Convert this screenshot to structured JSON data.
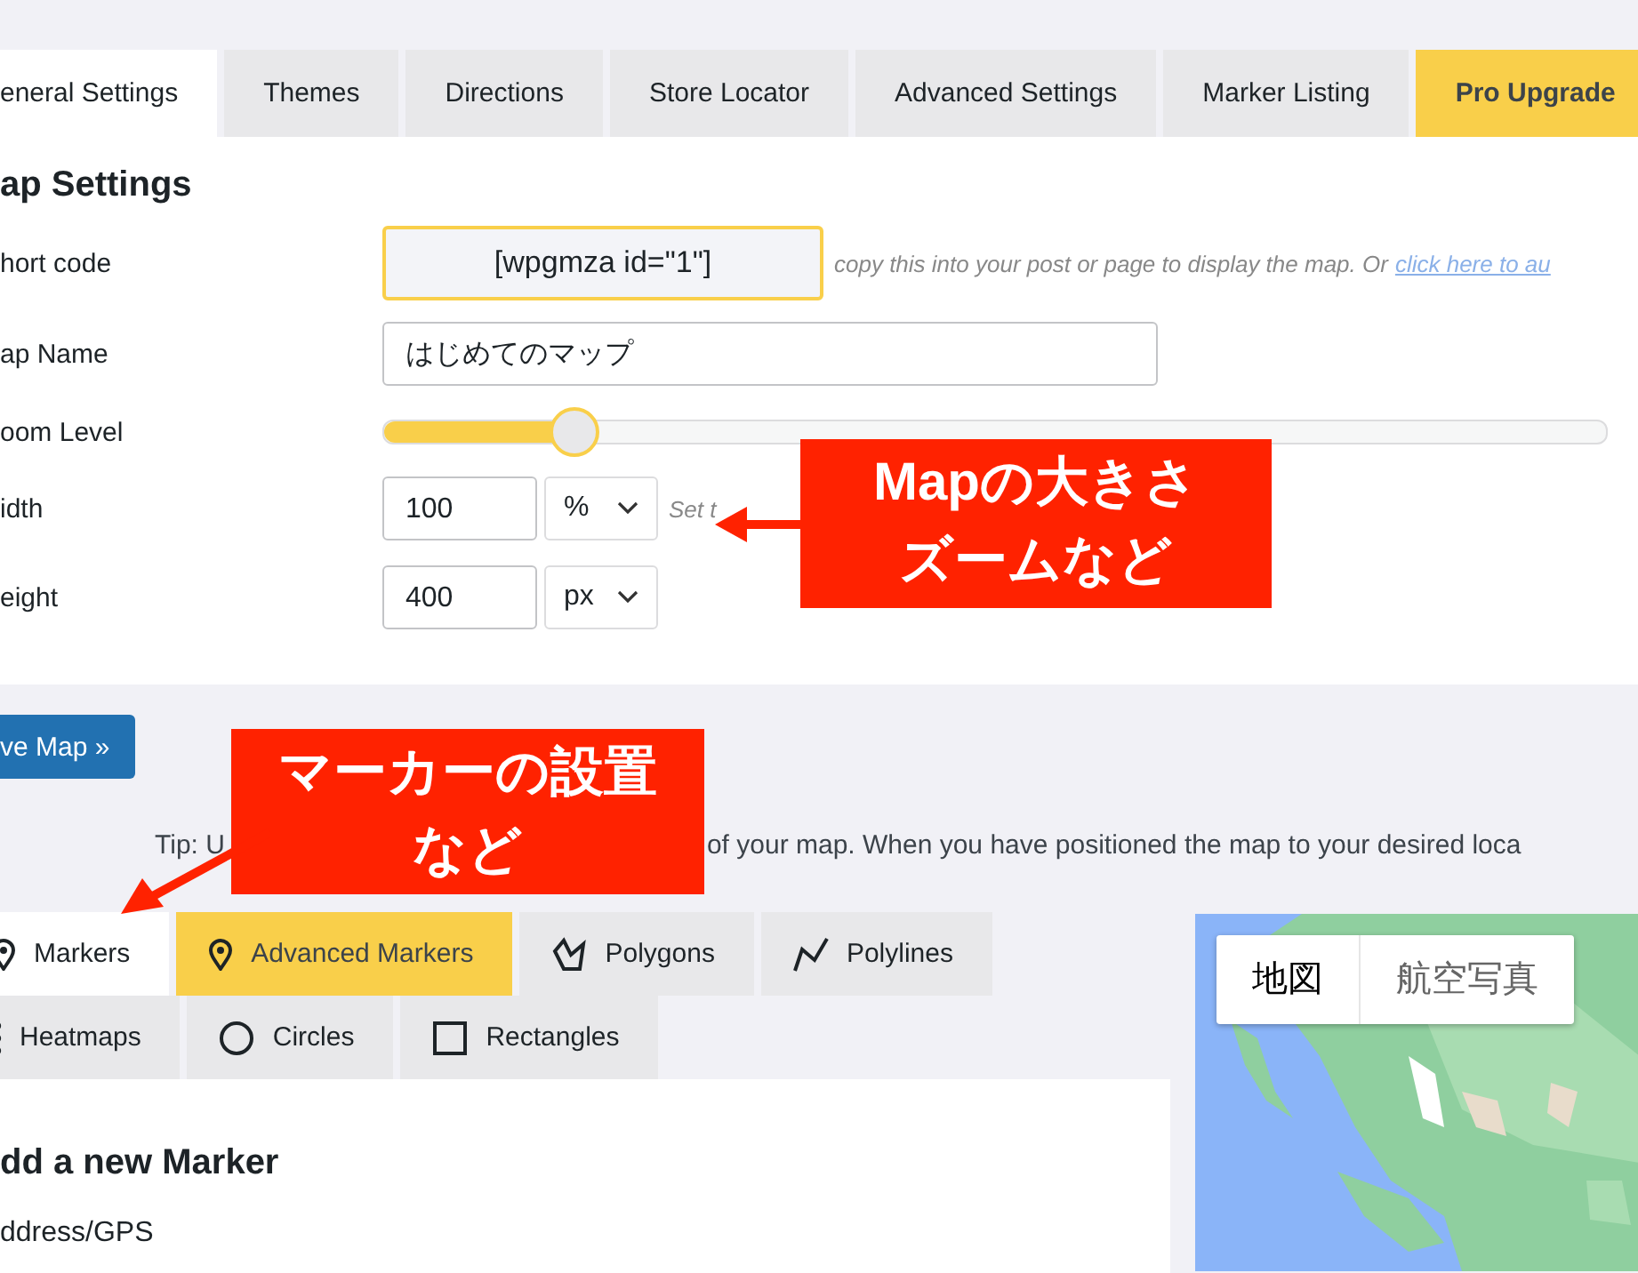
{
  "top_tabs": [
    {
      "label": "eneral Settings",
      "selected": true,
      "kind": "tab"
    },
    {
      "label": "Themes",
      "selected": false,
      "kind": "tab"
    },
    {
      "label": "Directions",
      "selected": false,
      "kind": "tab"
    },
    {
      "label": "Store Locator",
      "selected": false,
      "kind": "tab"
    },
    {
      "label": "Advanced Settings",
      "selected": false,
      "kind": "tab"
    },
    {
      "label": "Marker Listing",
      "selected": false,
      "kind": "tab"
    },
    {
      "label": "Pro Upgrade",
      "selected": false,
      "kind": "upgrade"
    }
  ],
  "map_settings": {
    "heading": "ap Settings",
    "rows": [
      {
        "kind": "shortcode",
        "label": "hort code",
        "value": "[wpgmza id=\"1\"]",
        "hint": "copy this into your post or page to display the map. Or",
        "link": "click here to au"
      },
      {
        "kind": "text",
        "label": "ap Name",
        "value": "はじめてのマップ"
      },
      {
        "kind": "slider",
        "label": "oom Level",
        "level": 0.155
      },
      {
        "kind": "size",
        "label": "idth",
        "value": "100",
        "unit": "%",
        "hint": "Set t"
      },
      {
        "kind": "size",
        "label": "eight",
        "value": "400",
        "unit": "px"
      }
    ]
  },
  "save_button": "ve Map »",
  "tip": {
    "before": "Tip: U",
    "after": "of your map. When you have positioned the map to your desired loca"
  },
  "feature_tabs": [
    [
      {
        "label": "Markers",
        "kind": "pin",
        "selected": true,
        "pro": false
      },
      {
        "label": "Advanced Markers",
        "kind": "pin",
        "selected": false,
        "pro": true
      },
      {
        "label": "Polygons",
        "kind": "polygon",
        "selected": false,
        "pro": false
      },
      {
        "label": "Polylines",
        "kind": "polyline",
        "selected": false,
        "pro": false
      }
    ],
    [
      {
        "label": "Heatmaps",
        "kind": "heatmap",
        "selected": false,
        "pro": false
      },
      {
        "label": "Circles",
        "kind": "circle",
        "selected": false,
        "pro": false
      },
      {
        "label": "Rectangles",
        "kind": "rectangle",
        "selected": false,
        "pro": false
      }
    ]
  ],
  "marker_panel": {
    "heading": "dd a new Marker",
    "field_label": "ddress/GPS"
  },
  "map": {
    "kind": "picture",
    "type_buttons": [
      {
        "label": "地図",
        "selected": true
      },
      {
        "label": "航空写真",
        "selected": false
      }
    ]
  },
  "annotations": [
    {
      "lines": [
        "Mapの大きさ",
        "ズームなど"
      ]
    },
    {
      "lines": [
        "マーカーの設置",
        "など"
      ]
    }
  ]
}
